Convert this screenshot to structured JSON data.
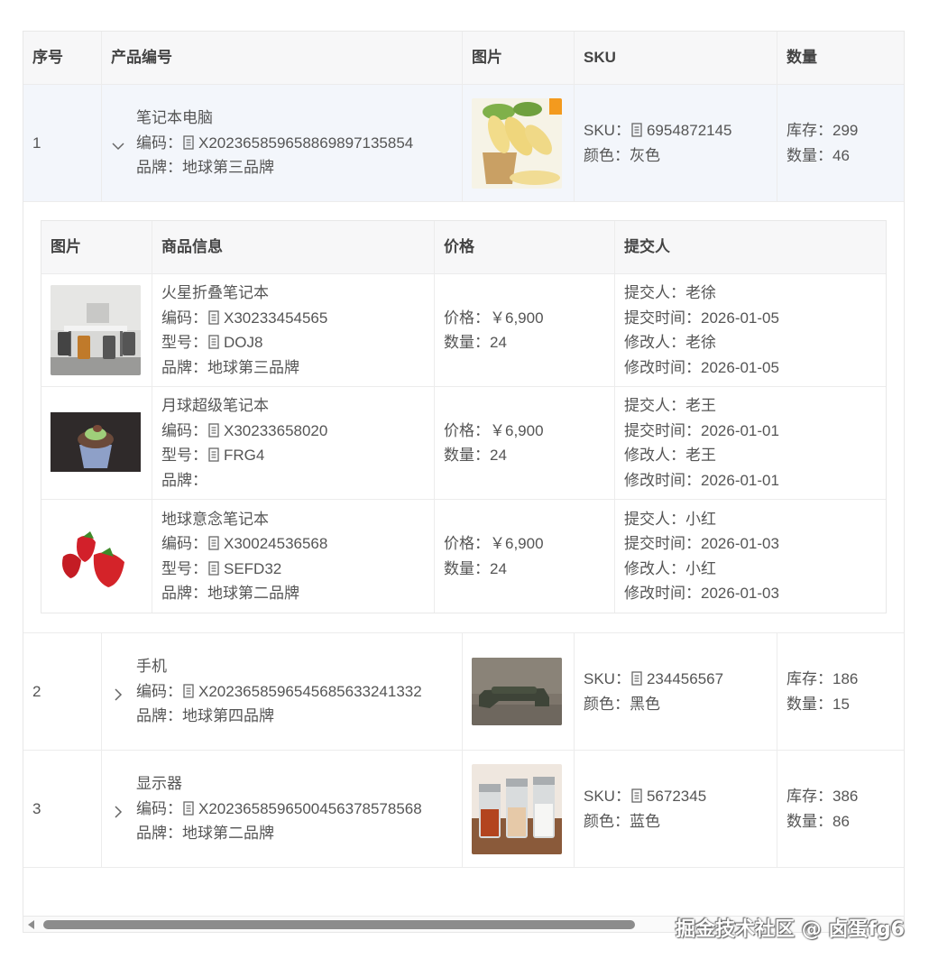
{
  "table": {
    "headers": {
      "index": "序号",
      "product": "产品编号",
      "image": "图片",
      "sku": "SKU",
      "quantity": "数量"
    },
    "rows": [
      {
        "index": "1",
        "name": "笔记本电脑",
        "code_label": "编码：",
        "code": "X20236585965886989713585​4",
        "brand": "品牌：地球第三品牌",
        "sku_label": "SKU：",
        "sku": "6954872145",
        "color": "颜色：灰色",
        "stock": "库存：299",
        "qty": "数量：46",
        "expanded": true
      },
      {
        "index": "2",
        "name": "手机",
        "code_label": "编码：",
        "code": "X20236585965456856332413​32",
        "brand": "品牌：地球第四品牌",
        "sku_label": "SKU：",
        "sku": "234456567",
        "color": "颜色：黑色",
        "stock": "库存：186",
        "qty": "数量：15",
        "expanded": false
      },
      {
        "index": "3",
        "name": "显示器",
        "code_label": "编码：",
        "code": "X20236585965004563785785​68",
        "brand": "品牌：地球第二品牌",
        "sku_label": "SKU：",
        "sku": "5672345",
        "color": "颜色：蓝色",
        "stock": "库存：386",
        "qty": "数量：86",
        "expanded": false
      }
    ]
  },
  "subtable": {
    "headers": {
      "image": "图片",
      "info": "商品信息",
      "price": "价格",
      "submitter": "提交人"
    },
    "rows": [
      {
        "name": "火星折叠笔记本",
        "code_label": "编码：",
        "code": "X30233454565",
        "model_label": "型号：",
        "model": "DOJ8",
        "brand": "品牌：地球第三品牌",
        "price": "价格：￥6,900",
        "qty": "数量：24",
        "submitter": "提交人：老徐",
        "submit_time": "提交时间：2026-01-05",
        "modifier": "修改人：老徐",
        "modify_time": "修改时间：2026-01-05"
      },
      {
        "name": "月球超级笔记本",
        "code_label": "编码：",
        "code": "X30233658020",
        "model_label": "型号：",
        "model": "FRG4",
        "brand": "品牌：",
        "price": "价格：￥6,900",
        "qty": "数量：24",
        "submitter": "提交人：老王",
        "submit_time": "提交时间：2026-01-01",
        "modifier": "修改人：老王",
        "modify_time": "修改时间：2026-01-01"
      },
      {
        "name": "地球意念笔记本",
        "code_label": "编码：",
        "code": "X30024536568",
        "model_label": "型号：",
        "model": "SEFD32",
        "brand": "品牌：地球第二品牌",
        "price": "价格：￥6,900",
        "qty": "数量：24",
        "submitter": "提交人：小红",
        "submit_time": "提交时间：2026-01-03",
        "modifier": "修改人：小红",
        "modify_time": "修改时间：2026-01-03"
      }
    ]
  },
  "icons": {
    "expand": "chevron-down-icon",
    "collapse": "chevron-right-icon",
    "copy": "copy-icon"
  },
  "colors": {
    "header_bg": "#f7f7f8",
    "expanded_row_bg": "#f3f6fb",
    "border": "#ececec"
  },
  "watermark": "掘金技术社区 @ 卤蛋fg6"
}
